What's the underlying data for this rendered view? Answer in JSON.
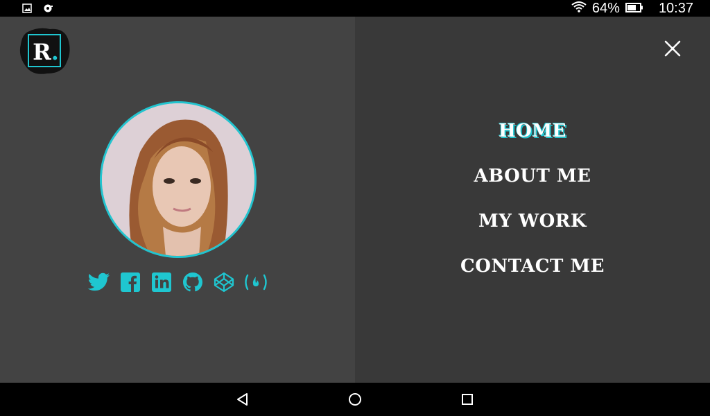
{
  "status_bar": {
    "left_icons": [
      "image-icon",
      "sync-icon"
    ],
    "battery_percent": "64%",
    "time": "10:37"
  },
  "logo": {
    "letter": "R",
    "dot": "."
  },
  "avatar": {
    "description_icon": "profile-photo"
  },
  "social": [
    "twitter-icon",
    "facebook-icon",
    "linkedin-icon",
    "github-icon",
    "codepen-icon",
    "freecodecamp-icon"
  ],
  "menu": {
    "items": [
      {
        "label": "HOME",
        "active": true
      },
      {
        "label": "ABOUT ME",
        "active": false
      },
      {
        "label": "MY WORK",
        "active": false
      },
      {
        "label": "CONTACT ME",
        "active": false
      }
    ]
  },
  "colors": {
    "accent": "#1fc6d0",
    "left_bg": "#434343",
    "right_bg": "#393939"
  },
  "navigation_bar": [
    "back-icon",
    "home-icon",
    "recents-icon"
  ]
}
